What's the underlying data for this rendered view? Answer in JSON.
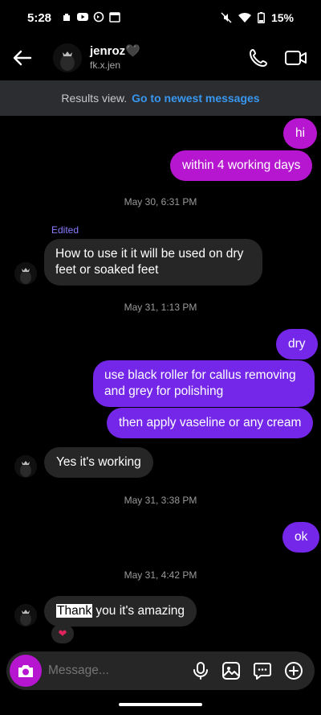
{
  "status_bar": {
    "time": "5:28",
    "battery": "15%",
    "left_icons": [
      "notification-icon",
      "youtube-icon",
      "sync-icon",
      "calendar-icon"
    ],
    "right_icons": [
      "mute-icon",
      "wifi-icon",
      "battery-icon"
    ]
  },
  "header": {
    "username": "jenroz🖤",
    "handle": "fk.x.jen"
  },
  "banner": {
    "text": "Results view.",
    "link": "Go to newest messages"
  },
  "messages": {
    "m1": "hi",
    "m2": "within 4 working days",
    "ts1": "May 30, 6:31 PM",
    "edited": "Edited",
    "m3": "How to use it it will be used on dry feet or soaked feet",
    "ts2": "May 31, 1:13 PM",
    "m4": "dry",
    "m5": "use black roller for callus removing and grey for polishing",
    "m6": "then apply vaseline or any cream",
    "m7": "Yes it's working",
    "ts3": "May 31, 3:38 PM",
    "m8": "ok",
    "ts4": "May 31, 4:42 PM",
    "m9_highlight": "Thank",
    "m9_rest": " you it's amazing",
    "reaction": "❤"
  },
  "composer": {
    "placeholder": "Message..."
  },
  "colors": {
    "pink_bubble": "#b616cf",
    "purple_bubble": "#7427e8",
    "incoming_bubble": "#262626",
    "link_blue": "#3897f0"
  }
}
